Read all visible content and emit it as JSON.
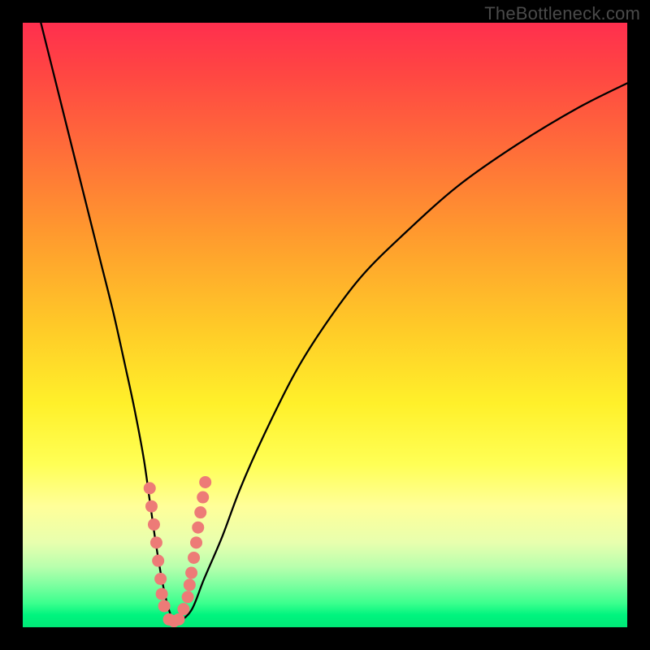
{
  "watermark": "TheBottleneck.com",
  "chart_data": {
    "type": "line",
    "title": "",
    "xlabel": "",
    "ylabel": "",
    "xlim": [
      0,
      100
    ],
    "ylim": [
      0,
      100
    ],
    "curve": {
      "name": "bottleneck-curve",
      "x": [
        3,
        5,
        7,
        9,
        11,
        13,
        15,
        17,
        18.5,
        20,
        21,
        22,
        23,
        24,
        25,
        26,
        28,
        30,
        33,
        36,
        40,
        45,
        50,
        56,
        63,
        72,
        82,
        92,
        100
      ],
      "y": [
        100,
        92,
        84,
        76,
        68,
        60,
        52,
        43,
        36,
        28,
        21,
        14,
        8,
        3.5,
        1,
        1,
        3,
        8,
        15,
        23,
        32,
        42,
        50,
        58,
        65,
        73,
        80,
        86,
        90
      ]
    },
    "markers": {
      "name": "highlight-dots",
      "color": "#ed7b77",
      "x": [
        21.0,
        21.3,
        21.7,
        22.1,
        22.4,
        22.8,
        23.0,
        23.4,
        24.2,
        25.0,
        25.8,
        26.6,
        27.3,
        27.6,
        27.9,
        28.3,
        28.7,
        29.0,
        29.4,
        29.8,
        30.2
      ],
      "y": [
        23.0,
        20.0,
        17.0,
        14.0,
        11.0,
        8.0,
        5.5,
        3.5,
        1.3,
        1.0,
        1.3,
        3.0,
        5.0,
        7.0,
        9.0,
        11.5,
        14.0,
        16.5,
        19.0,
        21.5,
        24.0
      ]
    }
  }
}
